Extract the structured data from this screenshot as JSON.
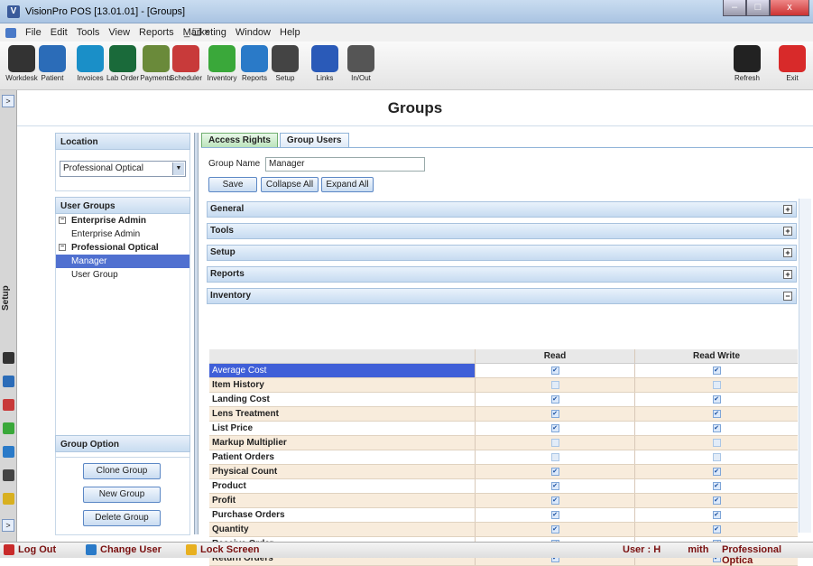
{
  "window": {
    "title": "VisionPro POS  [13.01.01] - [Groups]",
    "app_icon": "V"
  },
  "menu": {
    "items": [
      "File",
      "Edit",
      "Tools",
      "View",
      "Reports",
      "Marketing",
      "Window",
      "Help"
    ],
    "right": "_ &#9826; ×"
  },
  "toolbar": [
    {
      "label": "Workdesk",
      "icon": "workdesk-icon",
      "color": "#333"
    },
    {
      "label": "Patient",
      "icon": "patient-icon",
      "color": "#2b6cb8"
    },
    {
      "label": "Invoices",
      "icon": "invoices-icon",
      "color": "#1a8fc8"
    },
    {
      "label": "Lab Order",
      "icon": "lab-order-icon",
      "color": "#1a6a3a"
    },
    {
      "label": "Payments",
      "icon": "payments-icon",
      "color": "#6a8a3a"
    },
    {
      "label": "Scheduler",
      "icon": "scheduler-icon",
      "color": "#c83a3a"
    },
    {
      "label": "Inventory",
      "icon": "inventory-icon",
      "color": "#3aa83a"
    },
    {
      "label": "Reports",
      "icon": "reports-icon",
      "color": "#2a7ac8"
    },
    {
      "label": "Setup",
      "icon": "setup-icon",
      "color": "#444"
    },
    {
      "label": "Links",
      "icon": "links-icon",
      "color": "#2a5ab8"
    },
    {
      "label": "In/Out",
      "icon": "in-out-icon",
      "color": "#555"
    },
    {
      "label": "Refresh",
      "icon": "refresh-icon",
      "color": "#222"
    },
    {
      "label": "Exit",
      "icon": "exit-icon",
      "color": "#d82a2a"
    }
  ],
  "sidebar": {
    "label": "Setup",
    "expand": ">"
  },
  "page": {
    "title": "Groups"
  },
  "location": {
    "header": "Location",
    "value": "Professional Optical"
  },
  "user_groups": {
    "header": "User Groups",
    "tree": [
      {
        "label": "Enterprise Admin",
        "type": "group",
        "toggle": "−"
      },
      {
        "label": "Enterprise Admin",
        "type": "child"
      },
      {
        "label": "Professional Optical",
        "type": "group",
        "toggle": "−"
      },
      {
        "label": "Manager",
        "type": "child",
        "selected": true
      },
      {
        "label": "User Group",
        "type": "child"
      }
    ]
  },
  "group_option": {
    "header": "Group Option",
    "clone": "Clone Group",
    "new": "New Group",
    "delete": "Delete Group"
  },
  "tabs": [
    {
      "label": "Access Rights",
      "active": true
    },
    {
      "label": "Group Users",
      "active": false
    }
  ],
  "form": {
    "group_name_label": "Group Name",
    "group_name_value": "Manager",
    "save": "Save",
    "collapse_all": "Collapse All",
    "expand_all": "Expand All"
  },
  "sections": [
    {
      "label": "General",
      "toggle": "+"
    },
    {
      "label": "Tools",
      "toggle": "+"
    },
    {
      "label": "Setup",
      "toggle": "+"
    },
    {
      "label": "Reports",
      "toggle": "+"
    },
    {
      "label": "Inventory",
      "toggle": "−"
    }
  ],
  "grid": {
    "headers": [
      "",
      "Read",
      "Read Write"
    ],
    "rows": [
      {
        "name": "Average Cost",
        "read": true,
        "write": true
      },
      {
        "name": "Item History",
        "read": false,
        "write": false
      },
      {
        "name": "Landing Cost",
        "read": true,
        "write": true
      },
      {
        "name": "Lens Treatment",
        "read": true,
        "write": true
      },
      {
        "name": "List Price",
        "read": true,
        "write": true
      },
      {
        "name": "Markup Multiplier",
        "read": false,
        "write": false
      },
      {
        "name": "Patient Orders",
        "read": false,
        "write": false
      },
      {
        "name": "Physical Count",
        "read": true,
        "write": true
      },
      {
        "name": "Product",
        "read": true,
        "write": true
      },
      {
        "name": "Profit",
        "read": true,
        "write": true
      },
      {
        "name": "Purchase Orders",
        "read": true,
        "write": true
      },
      {
        "name": "Quantity",
        "read": true,
        "write": true
      },
      {
        "name": "Receive Order",
        "read": true,
        "write": true
      },
      {
        "name": "Return Orders",
        "read": true,
        "write": true
      }
    ]
  },
  "status": {
    "logout": "Log Out",
    "change_user": "Change User",
    "lock": "Lock Screen",
    "user": "User : H",
    "user_end": "mith",
    "location": "Professional Optica"
  }
}
